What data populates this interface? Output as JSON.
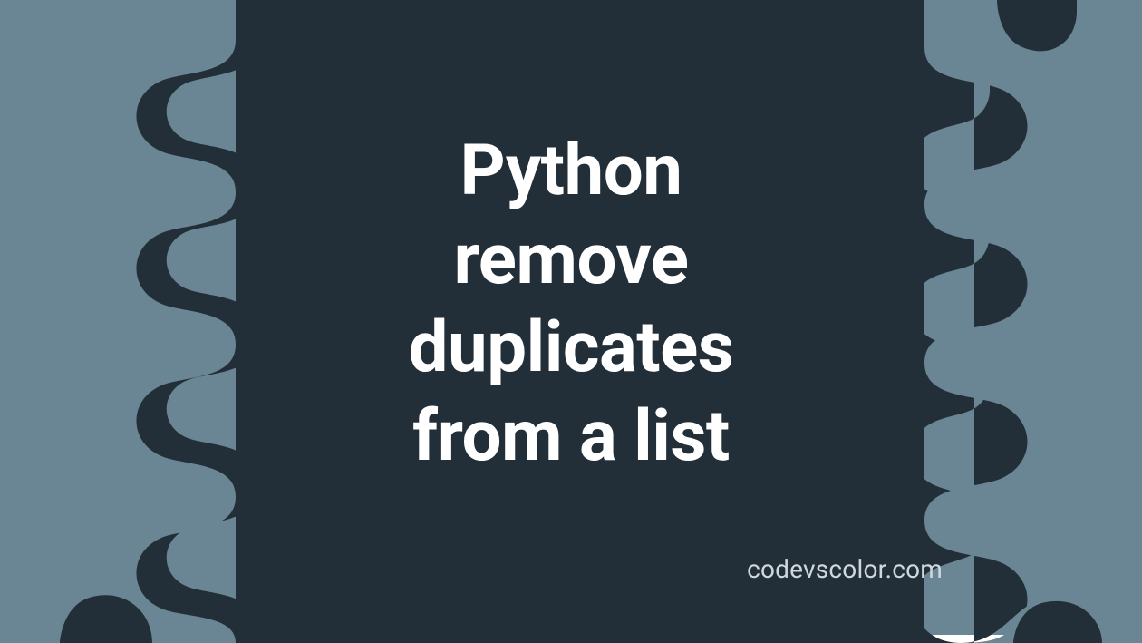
{
  "graphic": {
    "title": "Python\nremove\nduplicates\nfrom a list",
    "footer": "codevscolor.com",
    "colors": {
      "slab": "#6a8594",
      "blob": "#222f38",
      "text": "#ffffff",
      "subtext": "#cfd8dc",
      "page": "#ffffff"
    }
  }
}
